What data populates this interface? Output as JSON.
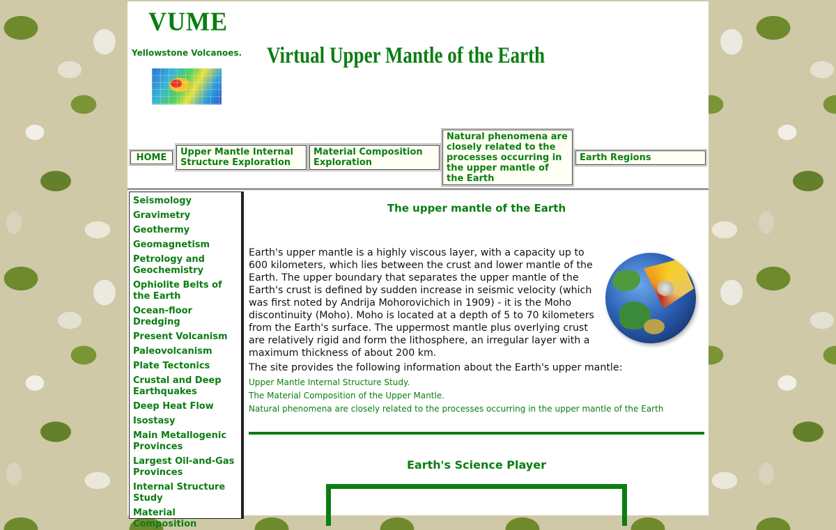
{
  "header": {
    "logo": "VUME",
    "sublink": "Yellowstone Volcanoes.",
    "title": "Virtual Upper Mantle of the Earth"
  },
  "topnav": {
    "home": "HOME",
    "internal": "Upper Mantle Internal Structure Exploration",
    "composition": "Material Composition Exploration",
    "phenomena": "Natural phenomena are closely related to the processes occurring in the upper mantle of the Earth",
    "regions": "Earth Regions"
  },
  "sidebar": {
    "items": [
      {
        "label": "Seismology"
      },
      {
        "label": "Gravimetry"
      },
      {
        "label": "Geothermy"
      },
      {
        "label": "Geomagnetism"
      },
      {
        "label": "Petrology and Geochemistry"
      },
      {
        "label": "Ophiolite Belts of the Earth"
      },
      {
        "label": "Ocean-floor Dredging"
      },
      {
        "label": "Present Volcanism"
      },
      {
        "label": "Paleovolcanism"
      },
      {
        "label": "Plate Tectonics"
      },
      {
        "label": "Crustal and Deep Earthquakes"
      },
      {
        "label": "Deep Heat Flow"
      },
      {
        "label": "Isostasy"
      },
      {
        "label": "Main Metallogenic Provinces"
      },
      {
        "label": "Largest Oil-and-Gas Provinces"
      },
      {
        "label": "Internal Structure Study"
      },
      {
        "label": "Material Composition"
      }
    ]
  },
  "main": {
    "heading": "The upper mantle of the Earth",
    "paragraph": "Earth's upper mantle is a highly viscous layer, with a capacity up to 600 kilometers, which lies between the crust and lower mantle of the Earth. The upper boundary that separates the upper mantle of the Earth's crust is defined by sudden increase in seismic velocity (which was first noted by Andrija Mohorovichich in 1909) - it is the Moho discontinuity (Moho). Moho is located at a depth of 5 to 70 kilometers from the Earth's surface. The uppermost mantle plus overlying crust are relatively rigid and form the lithosphere, an irregular layer with a maximum thickness of about 200 km.",
    "intro": "The site provides the following information about the Earth's upper mantle:",
    "links": [
      "Upper Mantle Internal Structure Study.",
      "The Material Composition of the Upper Mantle.",
      "Natural phenomena are closely related to the processes occurring in the upper mantle of the Earth"
    ],
    "player_heading": "Earth's Science Player"
  },
  "colors": {
    "accent": "#0b7d12",
    "page_bg": "#ffffff",
    "nav_bg": "#fffff4"
  },
  "icons": {
    "map_thumbnail": "yellowstone-map-icon",
    "earth_cutaway": "earth-cutaway-icon"
  }
}
